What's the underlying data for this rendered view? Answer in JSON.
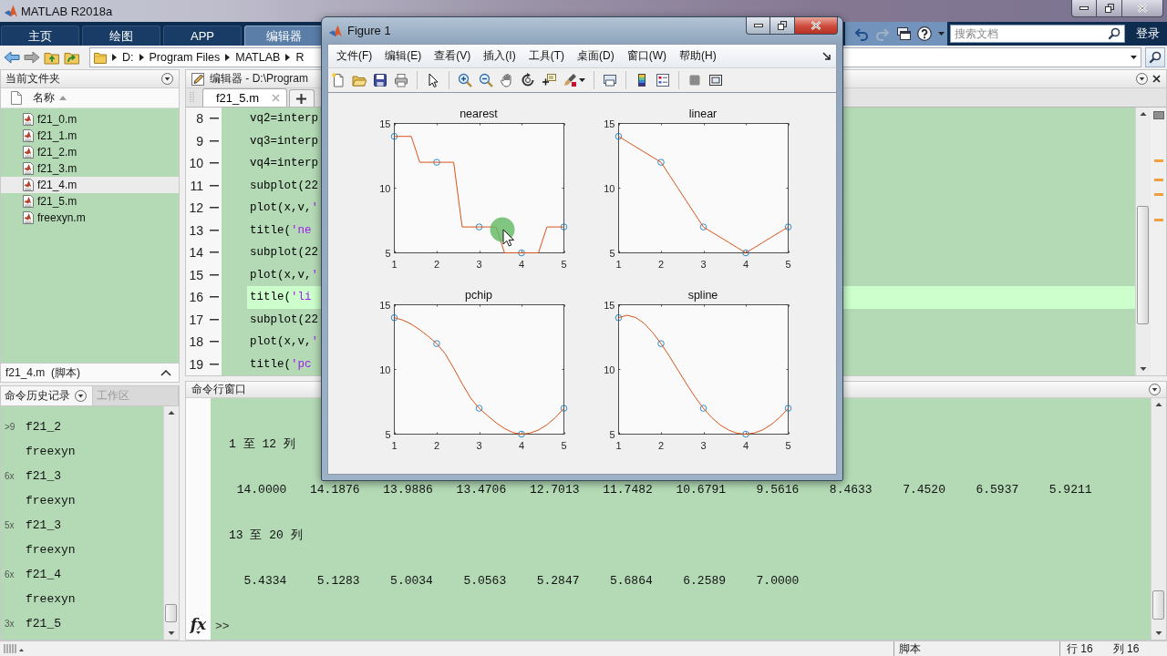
{
  "window": {
    "title": "MATLAB R2018a"
  },
  "ribbon": {
    "tabs": [
      {
        "label": "主页",
        "selected": false
      },
      {
        "label": "绘图",
        "selected": false
      },
      {
        "label": "APP",
        "selected": false
      },
      {
        "label": "编辑器",
        "selected": true
      }
    ],
    "search": {
      "placeholder": "搜索文档"
    },
    "sign_in": "登录"
  },
  "address_bar": {
    "path": [
      "D:",
      "Program Files",
      "MATLAB",
      "R"
    ]
  },
  "current_folder": {
    "title": "当前文件夹",
    "column": "名称",
    "files": [
      {
        "name": "f21_0.m",
        "selected": false
      },
      {
        "name": "f21_1.m",
        "selected": false
      },
      {
        "name": "f21_2.m",
        "selected": false
      },
      {
        "name": "f21_3.m",
        "selected": false
      },
      {
        "name": "f21_4.m",
        "selected": true
      },
      {
        "name": "f21_5.m",
        "selected": false
      },
      {
        "name": "freexyn.m",
        "selected": false
      }
    ],
    "details": "f21_4.m  (脚本)"
  },
  "command_history": {
    "tabs": [
      {
        "label": "命令历史记录",
        "selected": true
      },
      {
        "label": "工作区",
        "selected": false
      }
    ],
    "entries": [
      {
        "count": ">9",
        "command": "f21_2"
      },
      {
        "command": "freexyn"
      },
      {
        "count": "6x",
        "command": "f21_3"
      },
      {
        "command": "freexyn"
      },
      {
        "count": "5x",
        "command": "f21_3"
      },
      {
        "command": "freexyn"
      },
      {
        "count": "6x",
        "command": "f21_4"
      },
      {
        "command": "freexyn"
      },
      {
        "count": "3x",
        "command": "f21_5"
      }
    ]
  },
  "editor": {
    "title": "编辑器 - D:\\Program",
    "tabs": [
      {
        "label": "f21_5.m",
        "selected": true
      }
    ],
    "lines": [
      {
        "number": "8",
        "code": "vq2=interp",
        "highlighted": false
      },
      {
        "number": "9",
        "code": "vq3=interp",
        "highlighted": false
      },
      {
        "number": "10",
        "code": "vq4=interp",
        "highlighted": false
      },
      {
        "number": "11",
        "code": "subplot(22",
        "highlighted": false
      },
      {
        "number": "12",
        "code": "plot(x,v,'",
        "highlighted": false
      },
      {
        "number": "13",
        "code": "title('ne",
        "highlighted": false
      },
      {
        "number": "14",
        "code": "subplot(22",
        "highlighted": false
      },
      {
        "number": "15",
        "code": "plot(x,v,'",
        "highlighted": false
      },
      {
        "number": "16",
        "code": "title('li",
        "highlighted": true
      },
      {
        "number": "17",
        "code": "subplot(22",
        "highlighted": false
      },
      {
        "number": "18",
        "code": "plot(x,v,'",
        "highlighted": false
      },
      {
        "number": "19",
        "code": "title('pc",
        "highlighted": false
      }
    ]
  },
  "command_window": {
    "title": "命令行窗口",
    "output": [
      {
        "kind": "heading",
        "text": "1 至 12 列"
      },
      {
        "kind": "values",
        "values": [
          "14.0000",
          "14.1876",
          "13.9886",
          "13.4706",
          "12.7013",
          "11.7482",
          "10.6791",
          "9.5616",
          "8.4633",
          "7.4520",
          "6.5937",
          "5.9211"
        ]
      },
      {
        "kind": "heading",
        "text": "13 至 20 列"
      },
      {
        "kind": "values",
        "values": [
          "5.4334",
          "5.1283",
          "5.0034",
          "5.0563",
          "5.2847",
          "5.6864",
          "6.2589",
          "7.0000"
        ]
      }
    ],
    "function_button": "fx",
    "prompt": ">>"
  },
  "status_bar": {
    "mode": "脚本",
    "line": "行 16",
    "column": "列 16"
  },
  "figure": {
    "title": "Figure 1",
    "menu": [
      "文件(F)",
      "编辑(E)",
      "查看(V)",
      "插入(I)",
      "工具(T)",
      "桌面(D)",
      "窗口(W)",
      "帮助(H)"
    ],
    "plots": [
      {
        "chart_data": {
          "type": "line",
          "title": "nearest",
          "x": [
            1,
            1.2,
            1.4,
            1.6,
            1.8,
            2,
            2.2,
            2.4,
            2.6,
            2.8,
            3,
            3.2,
            3.4,
            3.6,
            3.8,
            4,
            4.2,
            4.4,
            4.6,
            4.8,
            5
          ],
          "series": [
            {
              "type": "scatter",
              "color": "#0072bd",
              "marker": "circle",
              "values": [
                14,
                null,
                null,
                null,
                null,
                12,
                null,
                null,
                null,
                null,
                7,
                null,
                null,
                null,
                null,
                5,
                null,
                null,
                null,
                null,
                7
              ]
            },
            {
              "color": "#d95319",
              "values": [
                14,
                14,
                14,
                12,
                12,
                12,
                12,
                12,
                7,
                7,
                7,
                7,
                7,
                5,
                5,
                5,
                5,
                5,
                7,
                7,
                7
              ]
            }
          ],
          "xlim": [
            1,
            5
          ],
          "ylim": [
            5,
            15
          ],
          "xticks": [
            1,
            2,
            3,
            4,
            5
          ],
          "yticks": [
            5,
            10,
            15
          ]
        }
      },
      {
        "chart_data": {
          "type": "line",
          "title": "linear",
          "x": [
            1,
            1.2,
            1.4,
            1.6,
            1.8,
            2,
            2.2,
            2.4,
            2.6,
            2.8,
            3,
            3.2,
            3.4,
            3.6,
            3.8,
            4,
            4.2,
            4.4,
            4.6,
            4.8,
            5
          ],
          "series": [
            {
              "type": "scatter",
              "color": "#0072bd",
              "marker": "circle",
              "values": [
                14,
                null,
                null,
                null,
                null,
                12,
                null,
                null,
                null,
                null,
                7,
                null,
                null,
                null,
                null,
                5,
                null,
                null,
                null,
                null,
                7
              ]
            },
            {
              "color": "#d95319",
              "values": [
                14,
                13.6,
                13.2,
                12.8,
                12.4,
                12,
                11,
                10,
                9,
                8,
                7,
                6.6,
                6.2,
                5.8,
                5.4,
                5,
                5.4,
                5.8,
                6.2,
                6.6,
                7
              ]
            }
          ],
          "xlim": [
            1,
            5
          ],
          "ylim": [
            5,
            15
          ],
          "xticks": [
            1,
            2,
            3,
            4,
            5
          ],
          "yticks": [
            5,
            10,
            15
          ]
        }
      },
      {
        "chart_data": {
          "type": "line",
          "title": "pchip",
          "x": [
            1,
            1.2,
            1.4,
            1.6,
            1.8,
            2,
            2.2,
            2.4,
            2.6,
            2.8,
            3,
            3.2,
            3.4,
            3.6,
            3.8,
            4,
            4.2,
            4.4,
            4.6,
            4.8,
            5
          ],
          "series": [
            {
              "type": "scatter",
              "color": "#0072bd",
              "marker": "circle",
              "values": [
                14,
                null,
                null,
                null,
                null,
                12,
                null,
                null,
                null,
                null,
                7,
                null,
                null,
                null,
                null,
                5,
                null,
                null,
                null,
                null,
                7
              ]
            },
            {
              "color": "#d95319",
              "values": [
                14,
                13.82,
                13.5,
                13.07,
                12.56,
                12,
                11.21,
                10.1,
                8.9,
                7.79,
                7,
                6.43,
                5.88,
                5.43,
                5.12,
                5,
                5.08,
                5.32,
                5.72,
                6.28,
                7
              ]
            }
          ],
          "xlim": [
            1,
            5
          ],
          "ylim": [
            5,
            15
          ],
          "xticks": [
            1,
            2,
            3,
            4,
            5
          ],
          "yticks": [
            5,
            10,
            15
          ]
        }
      },
      {
        "chart_data": {
          "type": "line",
          "title": "spline",
          "x": [
            1,
            1.2,
            1.4,
            1.6,
            1.8,
            2,
            2.2,
            2.4,
            2.6,
            2.8,
            3,
            3.2,
            3.4,
            3.6,
            3.8,
            4,
            4.2,
            4.4,
            4.6,
            4.8,
            5
          ],
          "series": [
            {
              "type": "scatter",
              "color": "#0072bd",
              "marker": "circle",
              "values": [
                14,
                null,
                null,
                null,
                null,
                12,
                null,
                null,
                null,
                null,
                7,
                null,
                null,
                null,
                null,
                5,
                null,
                null,
                null,
                null,
                7
              ]
            },
            {
              "color": "#d95319",
              "values": [
                14,
                14.19,
                14.02,
                13.57,
                12.87,
                12,
                11.01,
                9.95,
                8.9,
                7.89,
                7,
                6.27,
                5.7,
                5.31,
                5.07,
                5,
                5.09,
                5.33,
                5.74,
                6.29,
                7
              ]
            }
          ],
          "xlim": [
            1,
            5
          ],
          "ylim": [
            5,
            15
          ],
          "xticks": [
            1,
            2,
            3,
            4,
            5
          ],
          "yticks": [
            5,
            10,
            15
          ]
        }
      }
    ]
  }
}
